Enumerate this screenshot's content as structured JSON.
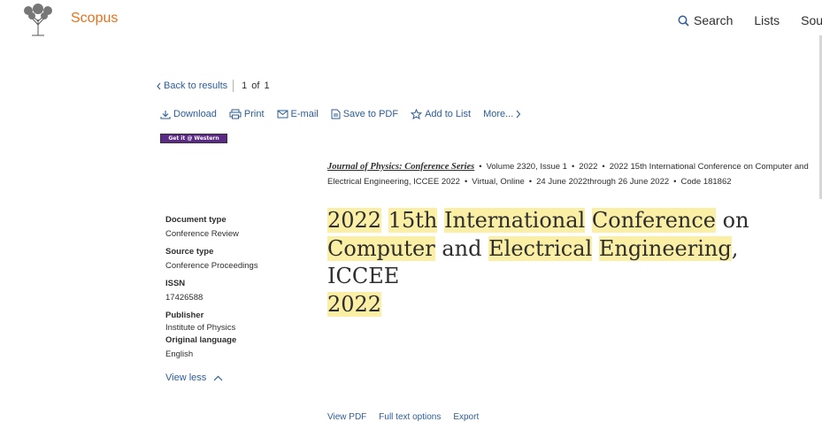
{
  "header": {
    "brand": "Scopus",
    "nav": {
      "search": "Search",
      "lists": "Lists",
      "sources": "Sou"
    }
  },
  "back": {
    "label": "Back to results",
    "current": "1",
    "of": "of",
    "total": "1"
  },
  "actions": {
    "download": "Download",
    "print": "Print",
    "email": "E-mail",
    "save_pdf": "Save to PDF",
    "add_list": "Add to List",
    "more": "More..."
  },
  "getit": "Get it @ Western",
  "citation": {
    "journal": "Journal of Physics: Conference Series",
    "volume": "Volume 2320, Issue 1",
    "year": "2022",
    "conference": "2022 15th International Conference on Computer and Electrical Engineering, ICCEE 2022",
    "location": "Virtual, Online",
    "dates": "24 June 2022through 26 June 2022",
    "code": "Code 181862"
  },
  "details": {
    "doc_type_label": "Document type",
    "doc_type_value": "Conference Review",
    "source_type_label": "Source type",
    "source_type_value": "Conference Proceedings",
    "issn_label": "ISSN",
    "issn_value": "17426588",
    "publisher_label": "Publisher",
    "publisher_value": "Institute of Physics",
    "language_label": "Original language",
    "language_value": "English",
    "view_less": "View less"
  },
  "title": {
    "w1": "2022",
    "w2": "15th",
    "w3": "International",
    "w4": "Conference",
    "w5": "on",
    "w6": "Computer",
    "w7": "and",
    "w8": "Electrical",
    "w9": "Engineering",
    "w10": ", ICCEE",
    "w11": "2022"
  },
  "bottom": {
    "item1": "View PDF",
    "item2": "Full text options",
    "item3": "Export"
  }
}
